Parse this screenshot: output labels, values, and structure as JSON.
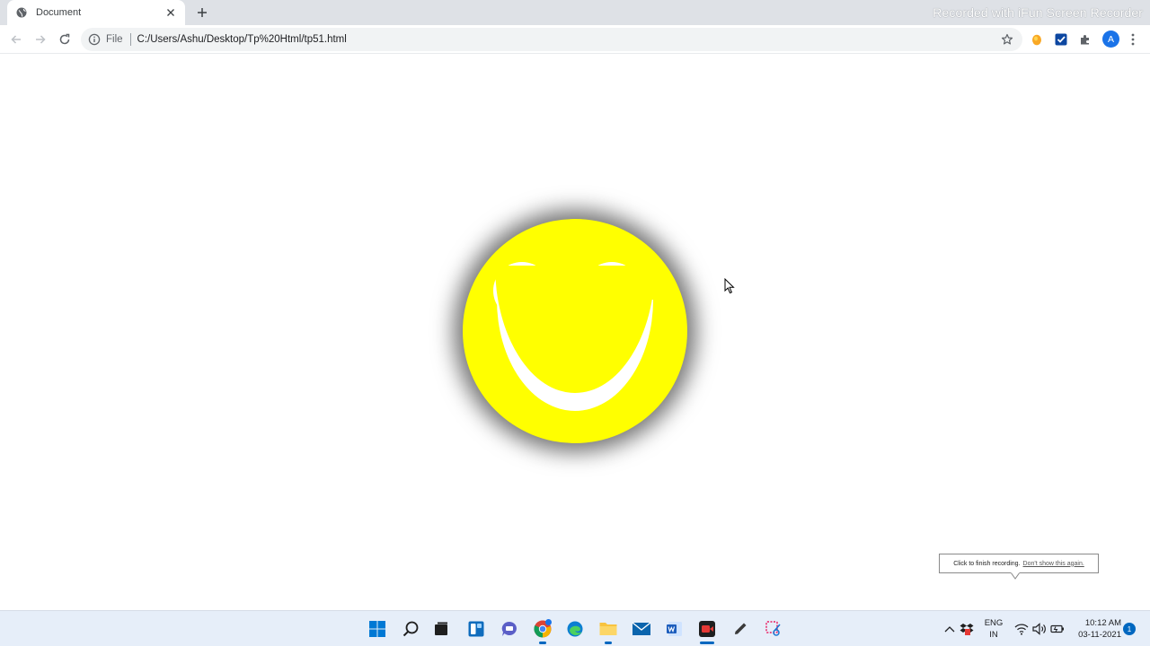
{
  "browser": {
    "tab": {
      "title": "Document",
      "favicon": "globe-icon"
    },
    "watermark": "Recorded with iFun Screen Recorder",
    "address_bar": {
      "scheme_label": "File",
      "url": "C:/Users/Ashu/Desktop/Tp%20Html/tp51.html"
    },
    "profile_initial": "A",
    "extensions": [
      "honey-extension-icon",
      "checkmark-extension-icon",
      "puzzle-icon"
    ]
  },
  "page": {
    "smiley": {
      "face_color": "#ffff00",
      "feature_color": "#ffffff"
    }
  },
  "recorder_tooltip": {
    "message": "Click to finish recording.",
    "link": "Don't show this again."
  },
  "taskbar": {
    "pinned": [
      "windows-start-icon",
      "search-icon",
      "task-view-icon",
      "widgets-icon",
      "teams-chat-icon",
      "chrome-icon",
      "edge-icon",
      "file-explorer-icon",
      "mail-icon",
      "word-icon",
      "screen-recorder-icon",
      "pen-icon",
      "snipping-tool-icon"
    ],
    "tray": {
      "language_line1": "ENG",
      "language_line2": "IN",
      "time": "10:12 AM",
      "date": "03-11-2021",
      "notification_count": "1"
    }
  }
}
